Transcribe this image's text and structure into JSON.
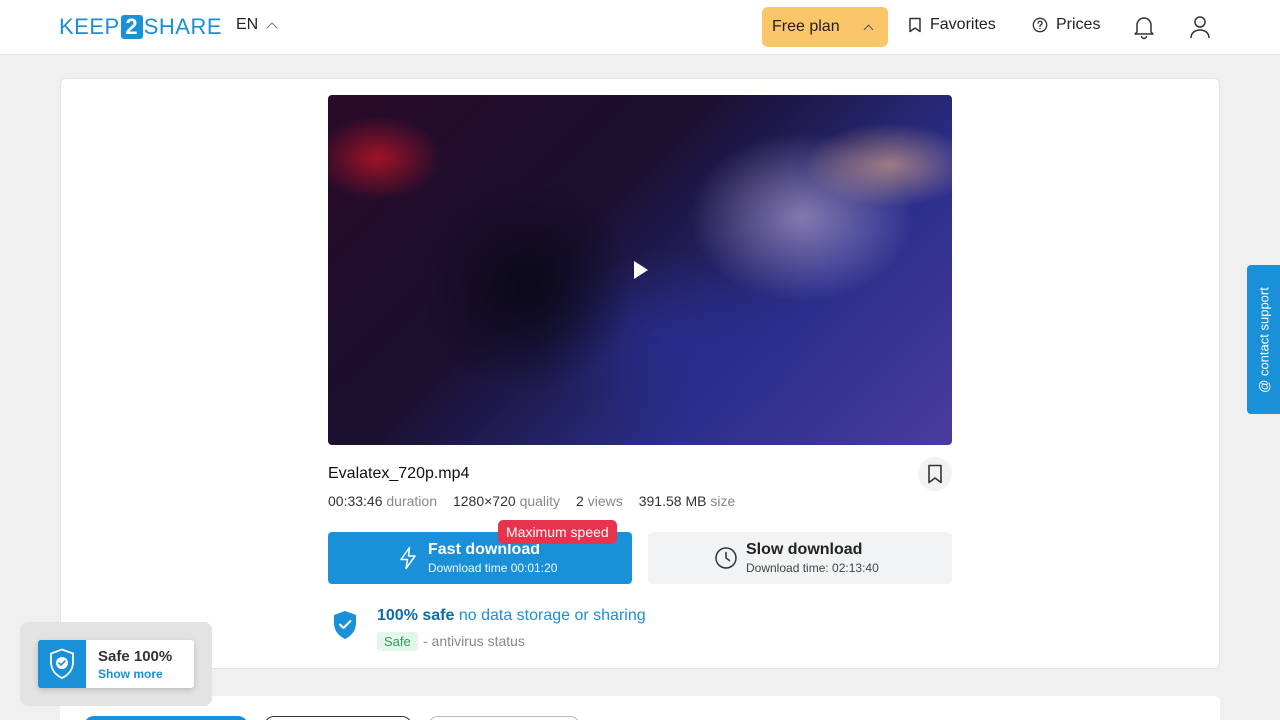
{
  "header": {
    "logo_left": "KEEP",
    "logo_mid": "2",
    "logo_right": "SHARE",
    "language": "EN",
    "plan_label": "Free plan",
    "favorites_label": "Favorites",
    "prices_label": "Prices"
  },
  "file": {
    "name": "Evalatex_720p.mp4",
    "duration": "00:33:46",
    "duration_label": "duration",
    "resolution": "1280×720",
    "resolution_label": "quality",
    "views": "2",
    "views_label": "views",
    "size": "391.58 MB",
    "size_label": "size"
  },
  "fast_download": {
    "badge": "Maximum speed",
    "title": "Fast download",
    "subtitle": "Download time 00:01:20"
  },
  "slow_download": {
    "title": "Slow download",
    "subtitle": "Download time: 02:13:40"
  },
  "safety": {
    "bold": "100% safe",
    "rest": "no data storage or sharing",
    "tag": "Safe",
    "status": "- antivirus status"
  },
  "support": {
    "label": "@ contact support"
  },
  "safe_widget": {
    "title": "Safe 100%",
    "link": "Show more"
  },
  "colors": {
    "accent": "#1a90d8",
    "plan": "#fbc56a",
    "badge": "#e8334f"
  }
}
